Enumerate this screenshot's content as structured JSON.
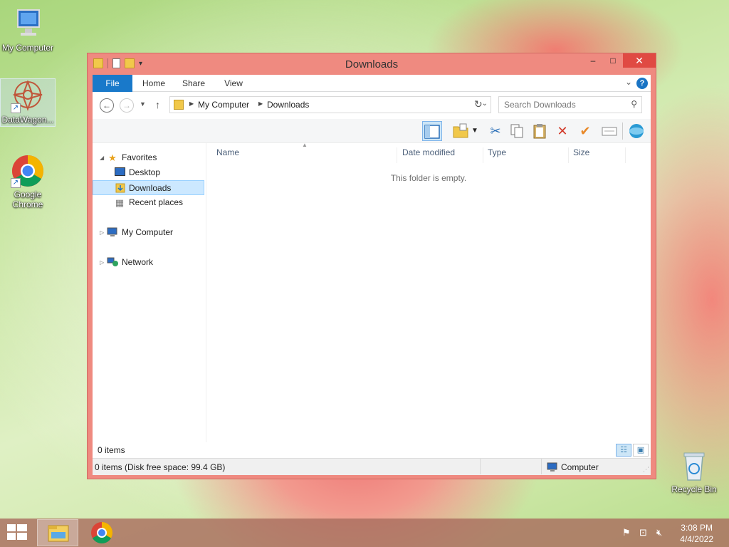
{
  "desktop": {
    "icons": [
      {
        "label": "My Computer"
      },
      {
        "label": "DataWagon..."
      },
      {
        "label": "Google Chrome"
      },
      {
        "label": "Recycle Bin"
      }
    ]
  },
  "window": {
    "title": "Downloads",
    "controls": {
      "minimize": "–",
      "maximize": "□",
      "close": "✕"
    },
    "ribbon_tabs": [
      "File",
      "Home",
      "Share",
      "View"
    ],
    "help": "?",
    "address": {
      "parts": [
        "My Computer",
        "Downloads"
      ]
    },
    "search_placeholder": "Search Downloads",
    "nav_pane": {
      "favorites": "Favorites",
      "items": [
        "Desktop",
        "Downloads",
        "Recent places"
      ],
      "computer": "My Computer",
      "network": "Network",
      "selected": "Downloads"
    },
    "columns": [
      "Name",
      "Date modified",
      "Type",
      "Size"
    ],
    "empty_message": "This folder is empty.",
    "status_count": "0 items",
    "bottom_status": "0 items (Disk free space: 99.4 GB)",
    "bottom_location": "Computer"
  },
  "taskbar": {
    "clock_time": "3:08 PM",
    "clock_date": "4/4/2022"
  },
  "colors": {
    "title_bar": "#ef8a80",
    "file_tab": "#1979ca",
    "selection": "#cce8ff"
  }
}
